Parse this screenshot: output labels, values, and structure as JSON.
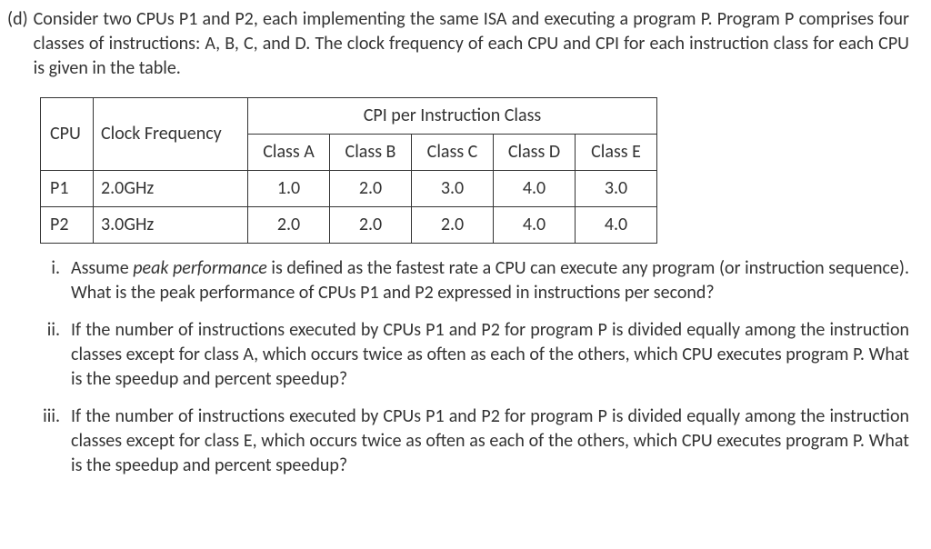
{
  "problem": {
    "label": "(d)",
    "intro": "Consider two CPUs P1 and P2, each implementing the same ISA and executing a program P. Program P comprises four classes of instructions: A, B, C, and D. The clock frequency of each CPU and CPI for each instruction class for each CPU is given in the table."
  },
  "table": {
    "header_cpu": "CPU",
    "header_freq": "Clock Frequency",
    "header_cpi": "CPI per Instruction Class",
    "class_labels": [
      "Class A",
      "Class B",
      "Class C",
      "Class D",
      "Class E"
    ],
    "rows": [
      {
        "cpu": "P1",
        "freq": "2.0GHz",
        "vals": [
          "1.0",
          "2.0",
          "3.0",
          "4.0",
          "3.0"
        ]
      },
      {
        "cpu": "P2",
        "freq": "3.0GHz",
        "vals": [
          "2.0",
          "2.0",
          "2.0",
          "4.0",
          "4.0"
        ]
      }
    ]
  },
  "subparts": [
    {
      "label": "i.",
      "pre_italic": "Assume ",
      "italic": "peak performance",
      "post_italic": " is defined as the fastest rate a CPU can execute any program (or instruction sequence). What is the peak performance of CPUs P1 and P2 expressed in instructions per second?"
    },
    {
      "label": "ii.",
      "text": "If the number of instructions executed by CPUs P1 and P2 for program P is divided equally among the instruction classes except for class A, which occurs twice as often as each of the others, which CPU executes program P.  What is the speedup and percent speedup?"
    },
    {
      "label": "iii.",
      "text": "If the number of instructions executed by CPUs P1 and P2 for program P is divided equally among the instruction classes except for class E, which occurs twice as often as each of the others, which CPU executes program P.  What is the speedup and percent speedup?"
    }
  ]
}
